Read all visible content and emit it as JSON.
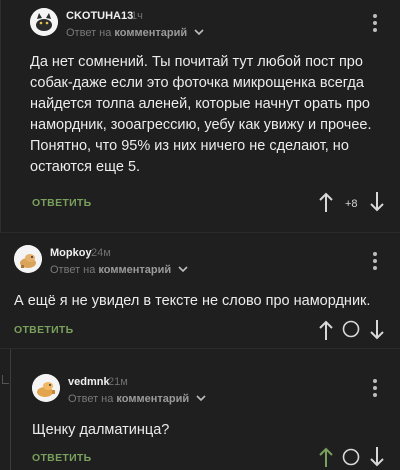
{
  "comments": [
    {
      "author": "CKOTUHA13",
      "time": "1ч",
      "reply_prefix": "Ответ на",
      "reply_target": "комментарий",
      "text": "Да нет сомнений. Ты почитай тут любой пост про собак-даже если это фоточка микрощенка всегда найдется толпа аленей, которые начнут орать про намордник, зооагрессию, уебу как увижу и прочее. Понятно, что 95% из них ничего не сделают, но остаются еще 5.",
      "reply_label": "ОТВЕТИТЬ",
      "rating": "+8"
    },
    {
      "author": "Mopkoy",
      "time": "24м",
      "reply_prefix": "Ответ на",
      "reply_target": "комментарий",
      "text": "А ещё я не увидел в тексте не слово про намордник.",
      "reply_label": "ОТВЕТИТЬ"
    },
    {
      "author": "vedmnk",
      "time": "21м",
      "reply_prefix": "Ответ на",
      "reply_target": "комментарий",
      "text": "Щенку далматинца?",
      "reply_label": "ОТВЕТИТЬ"
    }
  ],
  "colors": {
    "background": "#1f1f1f",
    "accent_green": "#7aa05d",
    "muted": "#7a7a7a",
    "upvote_active": "#7aa05d"
  },
  "icons": [
    "avatar-cat-icon",
    "avatar-dog-icon",
    "chevron-down-icon",
    "kebab-menu-icon",
    "upvote-arrow-icon",
    "downvote-arrow-icon",
    "save-circle-icon"
  ]
}
